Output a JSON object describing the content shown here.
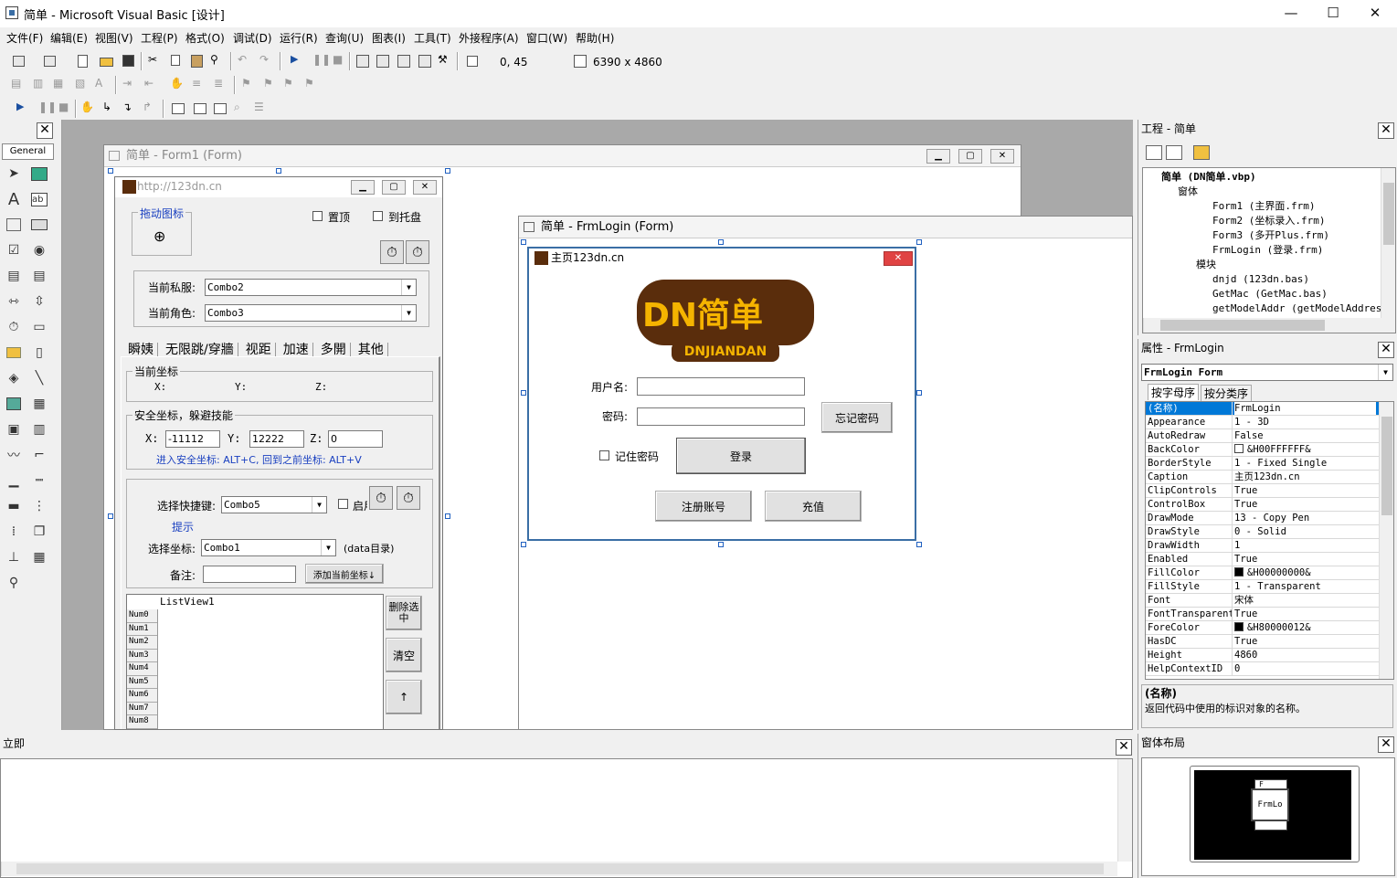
{
  "window": {
    "title": "简单 - Microsoft Visual Basic [设计]"
  },
  "menu": [
    "文件(F)",
    "编辑(E)",
    "视图(V)",
    "工程(P)",
    "格式(O)",
    "调试(D)",
    "运行(R)",
    "查询(U)",
    "图表(I)",
    "工具(T)",
    "外接程序(A)",
    "窗口(W)",
    "帮助(H)"
  ],
  "toolbar": {
    "position": "0, 45",
    "size": "6390 x 4860"
  },
  "toolbox": {
    "tab": "General"
  },
  "form1": {
    "window_title": "简单 - Form1 (Form)",
    "caption": "http://123dn.cn",
    "drag_icon_label": "拖动图标",
    "topmost": "置顶",
    "tray": "到托盘",
    "private_server_label": "当前私服:",
    "private_server_value": "Combo2",
    "role_label": "当前角色:",
    "role_value": "Combo3",
    "tabs": [
      "瞬姨",
      "无限跳/穿牆",
      "视距",
      "加速",
      "多開",
      "其他"
    ],
    "coord_frame": "当前坐标",
    "x_label": "X:",
    "y_label": "Y:",
    "z_label": "Z:",
    "safe_frame": "安全坐标，躲避技能",
    "safe_x": "-11112",
    "safe_y": "12222",
    "safe_z": "0",
    "safe_hint": "进入安全坐标: ALT+C, 回到之前坐标: ALT+V",
    "hotkey_label": "选择快捷键:",
    "hotkey_value": "Combo5",
    "enable_label": "启用",
    "hint_link": "提示",
    "select_coord_label": "选择坐标:",
    "select_coord_value": "Combo1",
    "data_dir": "(data目录)",
    "note_label": "备注:",
    "add_coord_button": "添加当前坐标↓",
    "listview": "ListView1",
    "rows": [
      "Num0",
      "Num1",
      "Num2",
      "Num3",
      "Num4",
      "Num5",
      "Num6",
      "Num7",
      "Num8"
    ],
    "delete_button": "删除选中",
    "clear_button": "清空",
    "up_button": "↑"
  },
  "frmlogin": {
    "window_title": "简单 - FrmLogin (Form)",
    "caption": "主页123dn.cn",
    "logo_main": "DN简单",
    "logo_sub": "DNJIANDAN",
    "username_label": "用户名:",
    "password_label": "密码:",
    "forgot_button": "忘记密码",
    "remember_label": "记住密码",
    "login_button": "登录",
    "register_button": "注册账号",
    "recharge_button": "充值"
  },
  "project": {
    "title": "工程 - 简单",
    "tree": [
      {
        "text": "简单 (DN简单.vbp)",
        "level": 0
      },
      {
        "text": "窗体",
        "level": 1
      },
      {
        "text": "Form1 (主界面.frm)",
        "level": 2
      },
      {
        "text": "Form2 (坐标录入.frm)",
        "level": 2
      },
      {
        "text": "Form3 (多开Plus.frm)",
        "level": 2
      },
      {
        "text": "FrmLogin (登录.frm)",
        "level": 2
      },
      {
        "text": "模块",
        "level": 1
      },
      {
        "text": "dnjd (123dn.bas)",
        "level": 2
      },
      {
        "text": "GetMac (GetMac.bas)",
        "level": 2
      },
      {
        "text": "getModelAddr (getModelAddress.",
        "level": 2
      }
    ]
  },
  "properties": {
    "title": "属性 - FrmLogin",
    "object": "FrmLogin Form",
    "tab_alpha": "按字母序",
    "tab_category": "按分类序",
    "rows": [
      {
        "name": "(名称)",
        "value": "FrmLogin"
      },
      {
        "name": "Appearance",
        "value": "1 - 3D"
      },
      {
        "name": "AutoRedraw",
        "value": "False"
      },
      {
        "name": "BackColor",
        "value": "&H00FFFFFF&",
        "swatch": "#ffffff"
      },
      {
        "name": "BorderStyle",
        "value": "1 - Fixed Single"
      },
      {
        "name": "Caption",
        "value": "主页123dn.cn"
      },
      {
        "name": "ClipControls",
        "value": "True"
      },
      {
        "name": "ControlBox",
        "value": "True"
      },
      {
        "name": "DrawMode",
        "value": "13 - Copy Pen"
      },
      {
        "name": "DrawStyle",
        "value": "0 - Solid"
      },
      {
        "name": "DrawWidth",
        "value": "1"
      },
      {
        "name": "Enabled",
        "value": "True"
      },
      {
        "name": "FillColor",
        "value": "&H00000000&",
        "swatch": "#000000"
      },
      {
        "name": "FillStyle",
        "value": "1 - Transparent"
      },
      {
        "name": "Font",
        "value": "宋体"
      },
      {
        "name": "FontTransparent",
        "value": "True"
      },
      {
        "name": "ForeColor",
        "value": "&H80000012&",
        "swatch": "#000000"
      },
      {
        "name": "HasDC",
        "value": "True"
      },
      {
        "name": "Height",
        "value": "4860"
      },
      {
        "name": "HelpContextID",
        "value": "0"
      }
    ],
    "desc_title": "(名称)",
    "desc_text": "返回代码中使用的标识对象的名称。"
  },
  "immediate": {
    "title": "立即"
  },
  "layout": {
    "title": "窗体布局",
    "form_a": "F",
    "form_b": "FrmLo"
  },
  "colors": {
    "selection": "#0078d7",
    "logo_brown": "#5a2d0c",
    "logo_yellow": "#f5b400"
  }
}
